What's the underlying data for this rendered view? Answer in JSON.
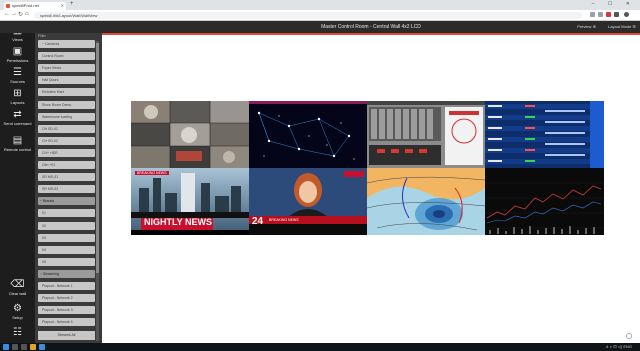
{
  "browser": {
    "tab_title": "spekt8Prod.net",
    "new_tab": "+",
    "window_controls": "– ☐ ✕",
    "back": "←",
    "forward": "→",
    "reload": "↻",
    "home": "⌂",
    "url": "spekt8.lt/#/Layout/Wall/WallView"
  },
  "header": {
    "title": "Master Control Room - Central Wall 4x2 LCD",
    "preview_button": "Preview ⊕",
    "layout_mode_button": "Layout Mode ☰"
  },
  "rail": {
    "items": [
      {
        "icon": "▦",
        "label": "Views"
      },
      {
        "icon": "▣",
        "label": "Permissions"
      },
      {
        "icon": "☰",
        "label": "Sources"
      },
      {
        "icon": "⊞",
        "label": "Layouts"
      },
      {
        "icon": "⇄",
        "label": "Send command"
      },
      {
        "icon": "▤",
        "label": "Remote control"
      },
      {
        "icon": "⌫",
        "label": "Clear wall"
      },
      {
        "icon": "⚙",
        "label": "Setup"
      },
      {
        "icon": "☷",
        "label": ""
      }
    ]
  },
  "sources": {
    "header": "Sources",
    "search_placeholder": "Filter",
    "items": [
      {
        "label": "~ Cameras",
        "section": false
      },
      {
        "label": "Control Room",
        "section": false
      },
      {
        "label": "Foyer Views",
        "section": false
      },
      {
        "label": "Hall Doors",
        "section": false
      },
      {
        "label": "Emirates Mart",
        "section": false
      },
      {
        "label": "Show Room Demo",
        "section": false
      },
      {
        "label": "Warehouse loading",
        "section": false
      },
      {
        "label": "CH SD-01",
        "section": false
      },
      {
        "label": "CH SD-02",
        "section": false
      },
      {
        "label": "CH+ HDR",
        "section": false
      },
      {
        "label": "Cttn +01",
        "section": false
      },
      {
        "label": "SR MS-01",
        "section": false
      },
      {
        "label": "SR MS-02",
        "section": false
      },
      {
        "label": "~ Brands",
        "section": true
      },
      {
        "label": "01",
        "section": false
      },
      {
        "label": "02",
        "section": false
      },
      {
        "label": "03",
        "section": false
      },
      {
        "label": "04",
        "section": false
      },
      {
        "label": "05",
        "section": false
      },
      {
        "label": "~ Streaming",
        "section": true
      },
      {
        "label": "Playout - Network 1",
        "section": false
      },
      {
        "label": "Playout - Network 2",
        "section": false
      },
      {
        "label": "Playout - Network 3",
        "section": false
      },
      {
        "label": "Playout - Network 4",
        "section": false
      }
    ],
    "bottom_button": "Streams All"
  },
  "wall": {
    "tiles": [
      {
        "label": "CCTV multiview"
      },
      {
        "label": "Network map"
      },
      {
        "label": "Audio console"
      },
      {
        "label": "Market data"
      },
      {
        "label": "BREAKING NEWS",
        "ticker": "NIGHTLY NEWS"
      },
      {
        "label": "BREAKING NEWS",
        "ticker": "24"
      },
      {
        "label": "Weather map"
      },
      {
        "label": "Trading chart"
      }
    ]
  },
  "taskbar": {
    "clock": "∧ ◐ ⊡ ◁) ENG"
  }
}
